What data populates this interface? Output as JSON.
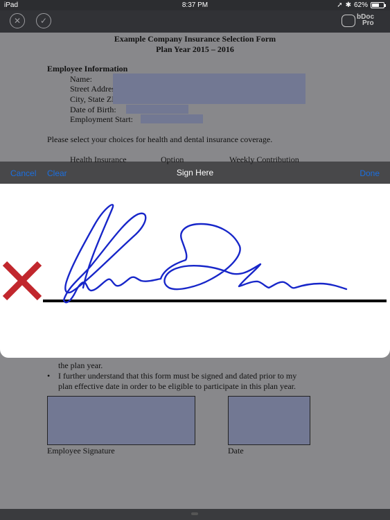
{
  "status_bar": {
    "device": "iPad",
    "time": "8:37 PM",
    "battery_percent": "62%",
    "battery_level": 0.62
  },
  "toolbar": {
    "cancel_icon": "x-circle-icon",
    "confirm_icon": "check-circle-icon",
    "logo_line1": "bDoc",
    "logo_line2": "Pro"
  },
  "document": {
    "title_line1": "Example Company Insurance Selection Form",
    "title_line2": "Plan Year 2015 – 2016",
    "section_heading": "Employee Information",
    "fields": [
      "Name:",
      "Street Address:",
      "City, State  ZIP:",
      "Date of Birth:",
      "Employment Start:"
    ],
    "instruction": "Please select your choices for health and dental insurance coverage.",
    "table_headers": [
      "Health Insurance",
      "Option",
      "Weekly Contribution"
    ],
    "partial_line": "the plan year.",
    "bullet_text_line1": "I further understand that this form must be signed and dated prior to my",
    "bullet_text_line2": "plan effective date in order to be eligible to participate in this plan year.",
    "employee_signature_label": "Employee Signature",
    "date_label": "Date",
    "redaction_color": "#727893"
  },
  "sign_sheet": {
    "cancel_label": "Cancel",
    "clear_label": "Clear",
    "title": "Sign Here",
    "done_label": "Done",
    "link_color": "#1b6fe0",
    "ink_color": "#1726c9",
    "x_mark_color": "#c1272d"
  }
}
